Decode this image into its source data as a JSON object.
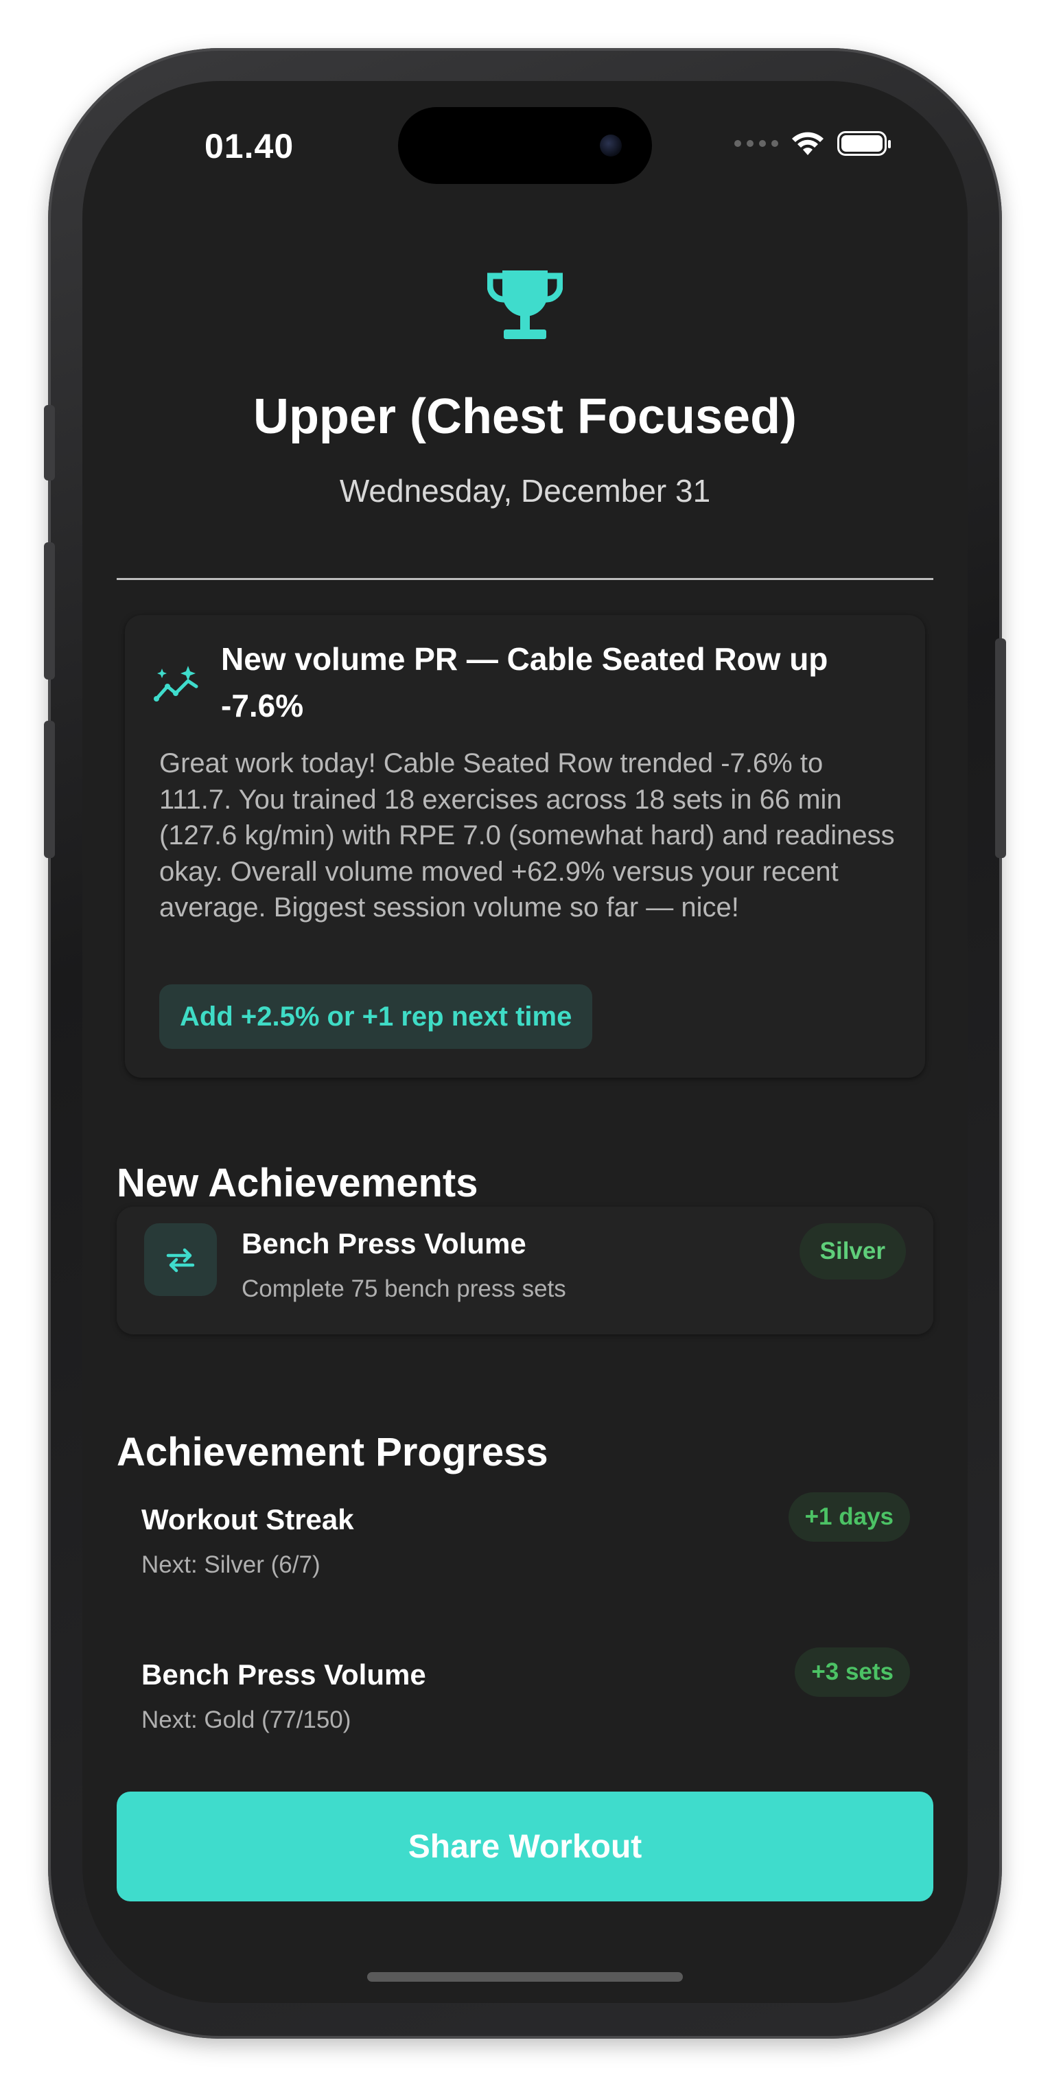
{
  "status_bar": {
    "time": "01.40",
    "icons": [
      "signal-dots-icon",
      "wifi-icon",
      "battery-icon"
    ]
  },
  "header": {
    "icon": "trophy-icon",
    "title": "Upper (Chest Focused)",
    "date": "Wednesday, December 31"
  },
  "insight": {
    "icon": "trend-sparkle-icon",
    "title": "New volume PR — Cable Seated Row up -7.6%",
    "body": "Great work today! Cable Seated Row trended -7.6% to 111.7. You trained 18 exercises across 18 sets in 66 min (127.6 kg/min) with RPE 7.0 (somewhat hard) and readiness okay. Overall volume moved +62.9% versus your recent average. Biggest session volume so far — nice!",
    "suggestion": "Add +2.5% or +1 rep next time"
  },
  "new_achievements": {
    "heading": "New Achievements",
    "items": [
      {
        "icon": "repeat-arrows-icon",
        "name": "Bench Press Volume",
        "description": "Complete 75 bench press sets",
        "tier": "Silver"
      }
    ]
  },
  "achievement_progress": {
    "heading": "Achievement Progress",
    "items": [
      {
        "name": "Workout Streak",
        "next": "Next: Silver (6/7)",
        "delta": "+1 days"
      },
      {
        "name": "Bench Press Volume",
        "next": "Next: Gold (77/150)",
        "delta": "+3 sets"
      }
    ]
  },
  "actions": {
    "share_label": "Share Workout"
  },
  "colors": {
    "accent": "#3fdccc",
    "background": "#1f1f1f",
    "badge_green": "#5fcf7a"
  }
}
